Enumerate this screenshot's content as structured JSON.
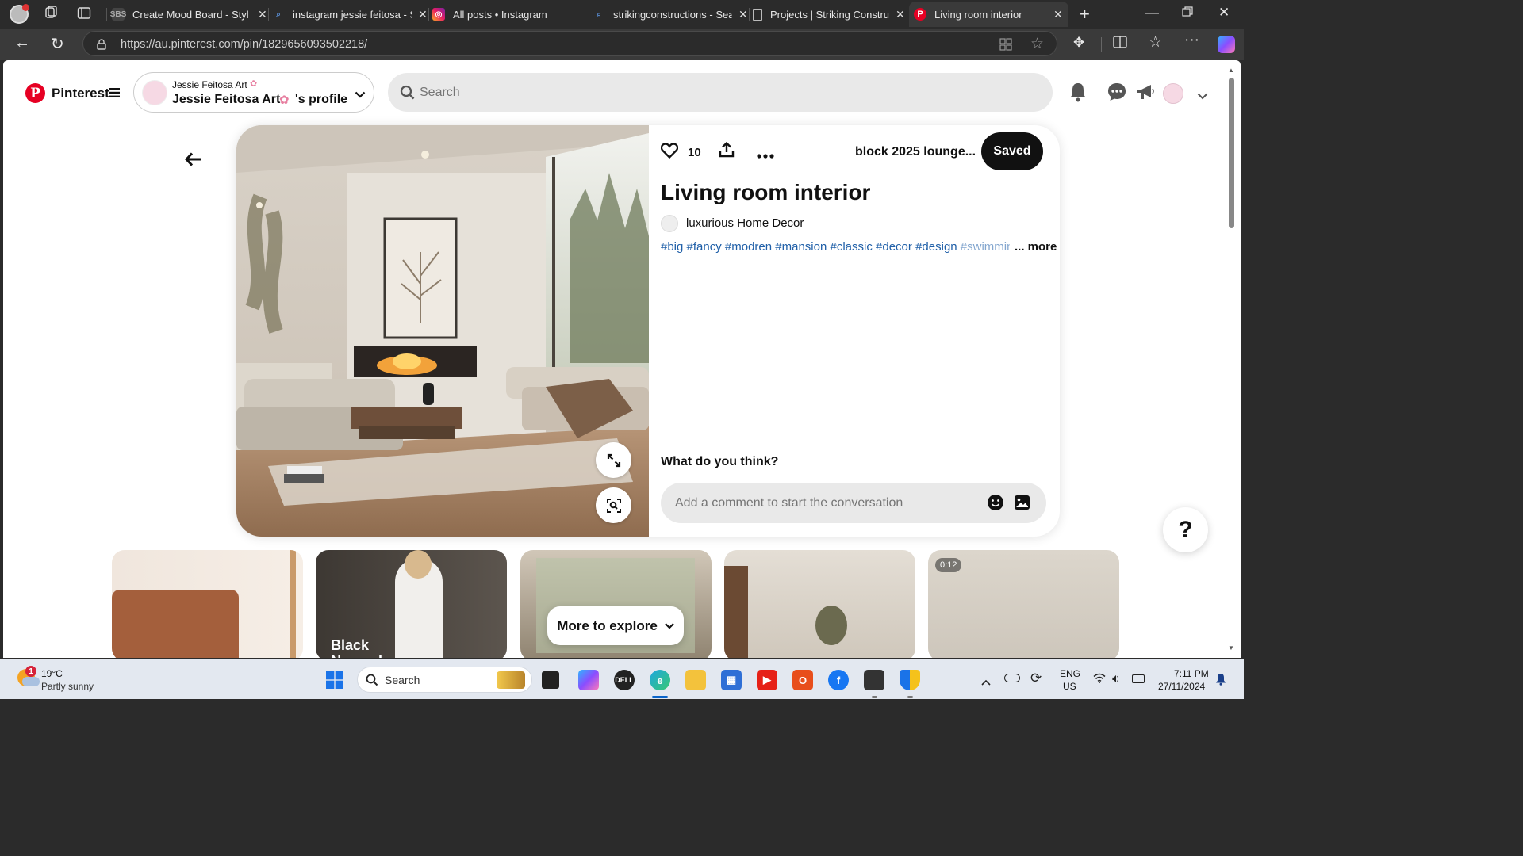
{
  "browser": {
    "tabs": [
      {
        "title": "Create Mood Board - Styl",
        "favicon": "sbs-favicon"
      },
      {
        "title": "instagram jessie feitosa - S",
        "favicon": "search-favicon"
      },
      {
        "title": "All posts • Instagram",
        "favicon": "instagram-favicon"
      },
      {
        "title": "strikingconstructions - Sea",
        "favicon": "search-favicon"
      },
      {
        "title": "Projects | Striking Constru",
        "favicon": "page-favicon"
      },
      {
        "title": "Living room interior",
        "favicon": "pinterest-favicon"
      }
    ],
    "url": "https://au.pinterest.com/pin/1829656093502218/"
  },
  "header": {
    "brand": "Pinterest",
    "account_small": "Jessie Feitosa Art",
    "account_profile_name": "Jessie Feitosa Art",
    "account_profile_suffix": "'s profile",
    "search_placeholder": "Search"
  },
  "pin": {
    "like_count": "10",
    "board_name": "block 2025 lounge...",
    "saved_label": "Saved",
    "title": "Living room interior",
    "creator": "luxurious Home Decor",
    "hashtags": [
      "#big",
      "#fancy",
      "#modren",
      "#mansion",
      "#classic",
      "#decor",
      "#design",
      "#swimming"
    ],
    "more_label": "... more",
    "comments_heading": "What do you think?",
    "comment_placeholder": "Add a comment to start the conversation"
  },
  "explore": {
    "button_label": "More to explore",
    "card2_text": "Black November",
    "card5_duration": "0:12"
  },
  "taskbar": {
    "weather_temp": "19°C",
    "weather_desc": "Partly sunny",
    "weather_badge": "1",
    "search_label": "Search",
    "lang_top": "ENG",
    "lang_bottom": "US",
    "time": "7:11 PM",
    "date": "27/11/2024"
  },
  "help_label": "?",
  "colors": {
    "pinterest_red": "#e60023",
    "saved_black": "#111111",
    "hashtag_blue": "#1f5fa8"
  }
}
